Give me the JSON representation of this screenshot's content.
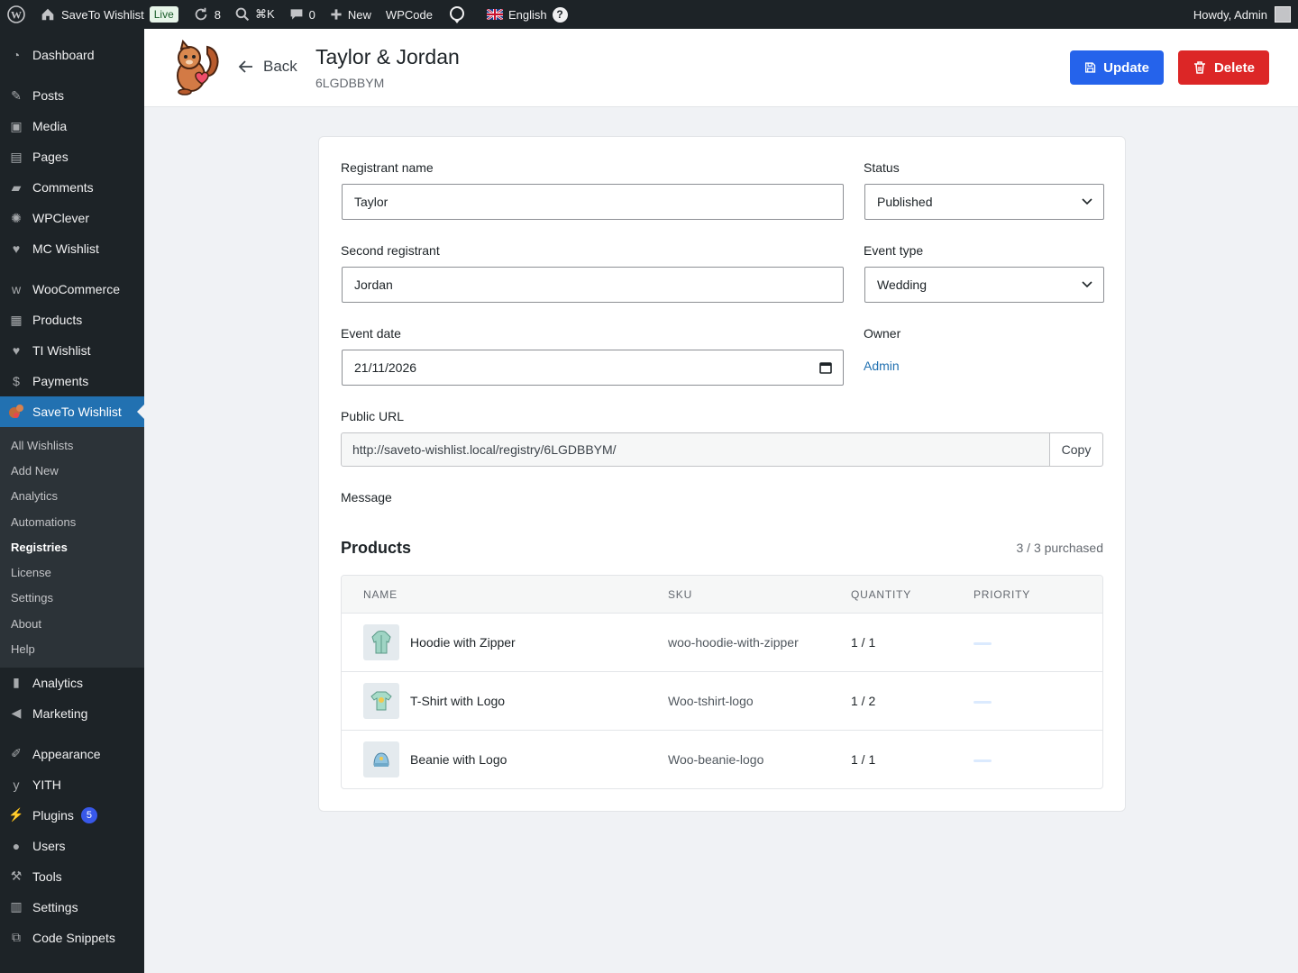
{
  "adminbar": {
    "site_name": "SaveTo Wishlist",
    "live_badge": "Live",
    "updates_count": "8",
    "search_shortcut": "⌘K",
    "comments_count": "0",
    "new_label": "New",
    "wpcode_label": "WPCode",
    "language_label": "English",
    "howdy": "Howdy, Admin"
  },
  "sidebar": {
    "items_top": [
      {
        "label": "Dashboard",
        "icon": "dashboard-icon"
      }
    ],
    "items_content": [
      {
        "label": "Posts",
        "icon": "pin-icon"
      },
      {
        "label": "Media",
        "icon": "media-icon"
      },
      {
        "label": "Pages",
        "icon": "pages-icon"
      },
      {
        "label": "Comments",
        "icon": "comment-icon"
      },
      {
        "label": "WPClever",
        "icon": "bulb-icon"
      },
      {
        "label": "MC Wishlist",
        "icon": "heart-icon"
      }
    ],
    "items_commerce": [
      {
        "label": "WooCommerce",
        "icon": "woo-icon"
      },
      {
        "label": "Products",
        "icon": "archive-icon"
      },
      {
        "label": "TI Wishlist",
        "icon": "heart-icon"
      },
      {
        "label": "Payments",
        "icon": "dollar-icon"
      }
    ],
    "active_item": {
      "label": "SaveTo Wishlist",
      "icon": "squirrel-icon"
    },
    "submenu": [
      "All Wishlists",
      "Add New",
      "Analytics",
      "Automations",
      "Registries",
      "License",
      "Settings",
      "About",
      "Help"
    ],
    "submenu_current": "Registries",
    "items_after": [
      {
        "label": "Analytics",
        "icon": "bar-chart-icon"
      },
      {
        "label": "Marketing",
        "icon": "megaphone-icon"
      }
    ],
    "items_bottom": [
      {
        "label": "Appearance",
        "icon": "brush-icon"
      },
      {
        "label": "YITH",
        "icon": "yith-icon"
      },
      {
        "label": "Plugins",
        "icon": "plugin-icon",
        "badge": "5"
      },
      {
        "label": "Users",
        "icon": "user-icon"
      },
      {
        "label": "Tools",
        "icon": "wrench-icon"
      },
      {
        "label": "Settings",
        "icon": "settings-icon"
      },
      {
        "label": "Code Snippets",
        "icon": "code-icon"
      }
    ]
  },
  "header": {
    "back_label": "Back",
    "title": "Taylor & Jordan",
    "code": "6LGDBBYM",
    "update_label": "Update",
    "delete_label": "Delete"
  },
  "form": {
    "registrant_label": "Registrant name",
    "registrant_value": "Taylor",
    "status_label": "Status",
    "status_value": "Published",
    "second_label": "Second registrant",
    "second_value": "Jordan",
    "event_type_label": "Event type",
    "event_type_value": "Wedding",
    "event_date_label": "Event date",
    "event_date_value": "21/11/2026",
    "owner_label": "Owner",
    "owner_value": "Admin",
    "public_url_label": "Public URL",
    "public_url_value": "http://saveto-wishlist.local/registry/6LGDBBYM/",
    "copy_label": "Copy",
    "message_label": "Message"
  },
  "products": {
    "title": "Products",
    "purchased": "3 / 3 purchased",
    "columns": [
      "NAME",
      "SKU",
      "QUANTITY",
      "PRIORITY"
    ],
    "rows": [
      {
        "name": "Hoodie with Zipper",
        "sku": "woo-hoodie-with-zipper",
        "qty": "1 / 1",
        "thumb": "hoodie-icon"
      },
      {
        "name": "T-Shirt with Logo",
        "sku": "Woo-tshirt-logo",
        "qty": "1 / 2",
        "thumb": "tshirt-icon"
      },
      {
        "name": "Beanie with Logo",
        "sku": "Woo-beanie-logo",
        "qty": "1 / 1",
        "thumb": "beanie-icon"
      }
    ]
  },
  "colors": {
    "primary": "#2563eb",
    "danger": "#dc2626",
    "wp_dark": "#1d2327",
    "wp_blue": "#2271b1"
  }
}
